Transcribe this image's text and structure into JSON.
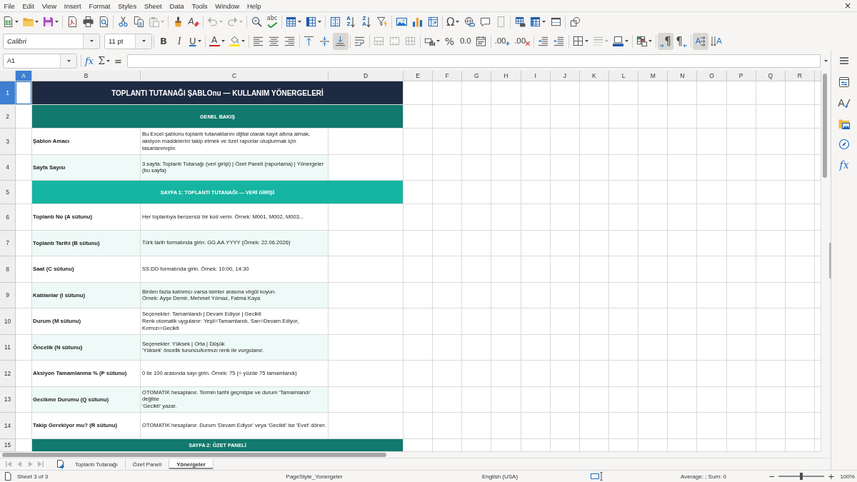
{
  "menu_bar": {
    "items": [
      "File",
      "Edit",
      "View",
      "Insert",
      "Format",
      "Styles",
      "Sheet",
      "Data",
      "Tools",
      "Window",
      "Help"
    ],
    "close": "×"
  },
  "standard_toolbar": {
    "items": [
      {
        "kind": "new",
        "dropdown": true,
        "disabled": false
      },
      {
        "kind": "open",
        "dropdown": true,
        "disabled": false
      },
      {
        "kind": "save",
        "dropdown": true,
        "disabled": false
      },
      {
        "kind": "separator"
      },
      {
        "kind": "export_pdf",
        "disabled": false
      },
      {
        "kind": "print",
        "disabled": false
      },
      {
        "kind": "print_preview",
        "disabled": false
      },
      {
        "kind": "separator"
      },
      {
        "kind": "cut",
        "disabled": false
      },
      {
        "kind": "copy",
        "disabled": false
      },
      {
        "kind": "paste",
        "dropdown": true,
        "disabled": true
      },
      {
        "kind": "separator"
      },
      {
        "kind": "clone_formatting",
        "disabled": false
      },
      {
        "kind": "clear_formatting",
        "label": "A",
        "disabled": false
      },
      {
        "kind": "separator"
      },
      {
        "kind": "undo",
        "dropdown": true,
        "disabled": true
      },
      {
        "kind": "redo",
        "dropdown": true,
        "disabled": true
      },
      {
        "kind": "separator"
      },
      {
        "kind": "find_replace",
        "disabled": false
      },
      {
        "kind": "spelling",
        "label": "abc",
        "disabled": false
      },
      {
        "kind": "separator"
      },
      {
        "kind": "rows",
        "dropdown": true,
        "disabled": false
      },
      {
        "kind": "columns",
        "dropdown": true,
        "disabled": false
      },
      {
        "kind": "separator"
      },
      {
        "kind": "sort",
        "disabled": false
      },
      {
        "kind": "sort_ascending",
        "label": "AZ",
        "disabled": false
      },
      {
        "kind": "sort_descending",
        "label": "ZA",
        "disabled": false
      },
      {
        "kind": "autofilter",
        "disabled": false
      },
      {
        "kind": "separator"
      },
      {
        "kind": "image",
        "disabled": false
      },
      {
        "kind": "chart",
        "disabled": false
      },
      {
        "kind": "pivot_table",
        "disabled": false
      },
      {
        "kind": "separator"
      },
      {
        "kind": "special_character",
        "label": "Ω",
        "dropdown": true,
        "disabled": false
      },
      {
        "kind": "hyperlink",
        "disabled": false
      },
      {
        "kind": "comment",
        "disabled": false
      },
      {
        "kind": "header_footer",
        "disabled": true
      },
      {
        "kind": "separator"
      },
      {
        "kind": "print_area",
        "disabled": false
      },
      {
        "kind": "freeze",
        "dropdown": true,
        "disabled": false
      },
      {
        "kind": "split_window",
        "disabled": false
      },
      {
        "kind": "separator"
      },
      {
        "kind": "shapes",
        "disabled": false
      }
    ]
  },
  "formatting_toolbar": {
    "font_name": "Calibri",
    "font_size": "11 pt",
    "items": [
      {
        "kind": "separator"
      },
      {
        "kind": "bold",
        "label": "B",
        "disabled": false,
        "pressed": false
      },
      {
        "kind": "italic",
        "label": "I",
        "disabled": false,
        "pressed": false
      },
      {
        "kind": "underline",
        "label": "U",
        "dropdown": true,
        "disabled": false,
        "pressed": false
      },
      {
        "kind": "separator"
      },
      {
        "kind": "font_color",
        "label": "A",
        "dropdown": true,
        "disabled": false,
        "pressed": false
      },
      {
        "kind": "highlight",
        "dropdown": true,
        "disabled": false,
        "pressed": false
      },
      {
        "kind": "separator"
      },
      {
        "kind": "align_left",
        "disabled": false,
        "pressed": false
      },
      {
        "kind": "align_center",
        "disabled": false,
        "pressed": false
      },
      {
        "kind": "align_right",
        "disabled": false,
        "pressed": false
      },
      {
        "kind": "separator"
      },
      {
        "kind": "align_top",
        "disabled": false,
        "pressed": false
      },
      {
        "kind": "align_middle",
        "disabled": false,
        "pressed": false
      },
      {
        "kind": "align_bottom",
        "disabled": false,
        "pressed": true
      },
      {
        "kind": "separator"
      },
      {
        "kind": "wrap_text",
        "disabled": false,
        "pressed": false
      },
      {
        "kind": "separator"
      },
      {
        "kind": "merge_center",
        "disabled": true,
        "pressed": false
      },
      {
        "kind": "merge",
        "disabled": true,
        "pressed": false
      },
      {
        "kind": "unmerge",
        "disabled": true,
        "pressed": false
      },
      {
        "kind": "separator"
      },
      {
        "kind": "currency",
        "dropdown": true,
        "disabled": false,
        "pressed": false
      },
      {
        "kind": "percent",
        "label": "%",
        "disabled": false,
        "pressed": false
      },
      {
        "kind": "number",
        "label": "0.0",
        "disabled": false,
        "pressed": false
      },
      {
        "kind": "date",
        "disabled": false,
        "pressed": false
      },
      {
        "kind": "separator"
      },
      {
        "kind": "add_decimal",
        "label": ".00",
        "disabled": false,
        "pressed": false
      },
      {
        "kind": "delete_decimal",
        "label": ".00",
        "disabled": false,
        "pressed": false
      },
      {
        "kind": "separator"
      },
      {
        "kind": "indent_increase",
        "disabled": false,
        "pressed": false
      },
      {
        "kind": "indent_decrease",
        "disabled": false,
        "pressed": false
      },
      {
        "kind": "separator"
      },
      {
        "kind": "borders",
        "dropdown": true,
        "disabled": false,
        "pressed": false
      },
      {
        "kind": "border_style",
        "dropdown": true,
        "disabled": true,
        "pressed": false
      },
      {
        "kind": "border_color",
        "dropdown": true,
        "disabled": false,
        "pressed": false
      },
      {
        "kind": "separator"
      },
      {
        "kind": "conditional",
        "dropdown": true,
        "disabled": false,
        "pressed": false
      },
      {
        "kind": "separator"
      },
      {
        "kind": "left_to_right",
        "label": "¶",
        "disabled": false,
        "pressed": true
      },
      {
        "kind": "right_to_left",
        "label": "¶",
        "disabled": false,
        "pressed": false
      },
      {
        "kind": "separator"
      },
      {
        "kind": "text_horizontal",
        "label": "A",
        "disabled": false,
        "pressed": true
      },
      {
        "kind": "text_vertical",
        "label": "A",
        "disabled": false,
        "pressed": false
      }
    ]
  },
  "formula_bar": {
    "name_box": "A1",
    "function_wizard": "fx",
    "sum": "Σ",
    "formula": "="
  },
  "sheet": {
    "columns": [
      {
        "label": "A",
        "selected": true
      },
      {
        "label": "B",
        "selected": false
      },
      {
        "label": "C",
        "selected": false
      },
      {
        "label": "D",
        "selected": false
      },
      {
        "label": "E",
        "selected": false
      },
      {
        "label": "F",
        "selected": false
      },
      {
        "label": "G",
        "selected": false
      },
      {
        "label": "H",
        "selected": false
      },
      {
        "label": "I",
        "selected": false
      },
      {
        "label": "J",
        "selected": false
      },
      {
        "label": "K",
        "selected": false
      },
      {
        "label": "L",
        "selected": false
      },
      {
        "label": "M",
        "selected": false
      },
      {
        "label": "N",
        "selected": false
      },
      {
        "label": "O",
        "selected": false
      },
      {
        "label": "P",
        "selected": false
      },
      {
        "label": "Q",
        "selected": false
      },
      {
        "label": "R",
        "selected": false
      }
    ],
    "rows": [
      {
        "number": "1",
        "selected": true,
        "kind": "title",
        "text": "TOPLANTI TUTANAĞI ŞABLOnu — KULLANIM YÖNERGELERİ",
        "color": "#1e2a42"
      },
      {
        "number": "2",
        "selected": false,
        "kind": "section",
        "text": "GENEL BAKIŞ",
        "color": "#11796d"
      },
      {
        "number": "3",
        "selected": false,
        "kind": "item",
        "shaded": false,
        "label": "Şablon Amacı",
        "description": "Bu Excel şablonu toplantı tutanaklarını dijital olarak kayıt altına almak, aksiyon maddelerini takip etmek ve özet raporlar oluşturmak için tasarlanmıştır."
      },
      {
        "number": "4",
        "selected": false,
        "kind": "item",
        "shaded": true,
        "label": "Sayfa Sayısı",
        "description": "3 sayfa: Toplantı Tutanağı (veri girişi) | Özet Paneli (raporlama) | Yönergeler (bu sayfa)"
      },
      {
        "number": "5",
        "selected": false,
        "kind": "section",
        "text": "SAYFA 1: TOPLANTI TUTANAĞI — VERİ GİRİŞİ",
        "color": "#16b5a2"
      },
      {
        "number": "6",
        "selected": false,
        "kind": "item",
        "shaded": false,
        "label": "Toplantı No (A sütunu)",
        "description": "Her toplantıya benzersiz bir kod verin. Örnek: M001, M002, M003..."
      },
      {
        "number": "7",
        "selected": false,
        "kind": "item",
        "shaded": true,
        "label": "Toplantı Tarihi (B sütunu)",
        "description": "Türk tarih formatında girin: GG.AA.YYYY (Örnek: 22.06.2026)"
      },
      {
        "number": "8",
        "selected": false,
        "kind": "item",
        "shaded": false,
        "label": "Saat (C sütunu)",
        "description": "SS:DD formatında girin. Örnek: 10:00, 14:30"
      },
      {
        "number": "9",
        "selected": false,
        "kind": "item",
        "shaded": true,
        "label": "Katılanlar (I sütunu)",
        "description": "Birden fazla katılımcı varsa isimler arasına virgül koyun.\nÖrnek: Ayşe Demir, Mehmet Yılmaz, Fatma Kaya"
      },
      {
        "number": "10",
        "selected": false,
        "kind": "item",
        "shaded": false,
        "label": "Durum (M sütunu)",
        "description": "Seçenekler: Tamamlandı | Devam Ediyor | Gecikti\nRenk otomatik uygulanır: Yeşil=Tamamlandı, Sarı=Devam Ediyor, Kırmızı=Gecikti"
      },
      {
        "number": "11",
        "selected": false,
        "kind": "item",
        "shaded": true,
        "label": "Öncelik (N sütunu)",
        "description": "Seçenekler: Yüksek | Orta | Düşük\n'Yüksek' öncelik turuncu/kırmızı renk ile vurgulanır."
      },
      {
        "number": "12",
        "selected": false,
        "kind": "item",
        "shaded": false,
        "label": "Aksiyon Tamamlanma % (P sütunu)",
        "description": "0 ile 100 arasında sayı girin. Örnek: 75 (= yüzde 75 tamamlandı)"
      },
      {
        "number": "13",
        "selected": false,
        "kind": "item",
        "shaded": true,
        "label": "Gecikme Durumu (Q sütunu)",
        "description": "OTOMATİK hesaplanır. Termin tarihi geçmişse ve durum 'Tamamlandı' değilse\n'Gecikti' yazar."
      },
      {
        "number": "14",
        "selected": false,
        "kind": "item",
        "shaded": false,
        "label": "Takip Gerekiyor mu? (R sütunu)",
        "description": "OTOMATİK hesaplanır. Durum 'Devam Ediyor' veya 'Gecikti' ise 'Evet' döner."
      },
      {
        "number": "15",
        "selected": false,
        "kind": "section",
        "text": "SAYFA 2: ÖZET PANELİ",
        "color": "#11796d"
      }
    ]
  },
  "sheet_tabs": {
    "navigation": [
      {
        "kind": "first",
        "disabled": true
      },
      {
        "kind": "previous",
        "disabled": true
      },
      {
        "kind": "next",
        "disabled": true
      },
      {
        "kind": "last",
        "disabled": true
      }
    ],
    "tabs": [
      {
        "label": "Toplantı Tutanağı",
        "selected": false
      },
      {
        "label": "Özet Paneli",
        "selected": false
      },
      {
        "label": "Yönergeler",
        "selected": true
      }
    ]
  },
  "sidebar": {
    "items": [
      {
        "kind": "properties"
      },
      {
        "kind": "styles",
        "label": "A"
      },
      {
        "kind": "gallery"
      },
      {
        "kind": "navigator"
      },
      {
        "kind": "functions",
        "label": "fx"
      }
    ]
  },
  "status_bar": {
    "sheet_position": "Sheet 3 of 3",
    "page_style": "PageStyle_Yonergeler",
    "language": "English (USA)",
    "selection_summary": "Average: ; Sum: 0",
    "zoom": {
      "zoom_out": "−",
      "zoom_in": "+",
      "level": 0.5,
      "reading": "100%"
    }
  }
}
